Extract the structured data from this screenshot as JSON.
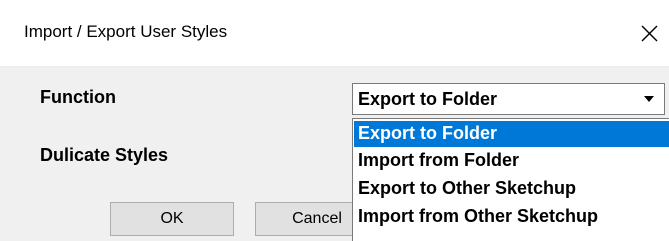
{
  "window": {
    "title": "Import / Export User Styles",
    "close_icon": "close-icon"
  },
  "form": {
    "function_label": "Function",
    "duplicate_label": "Dulicate Styles"
  },
  "function_select": {
    "selected_value": "Export to Folder",
    "arrow_icon": "chevron-down-icon",
    "options": [
      {
        "label": "Export to Folder",
        "highlighted": true
      },
      {
        "label": "Import from Folder",
        "highlighted": false
      },
      {
        "label": "Export to Other Sketchup",
        "highlighted": false
      },
      {
        "label": "Import from Other Sketchup",
        "highlighted": false
      }
    ]
  },
  "buttons": {
    "ok_label": "OK",
    "cancel_label": "Cancel"
  },
  "colors": {
    "highlight": "#0078d7",
    "dialog_background": "#f0f0f0"
  }
}
